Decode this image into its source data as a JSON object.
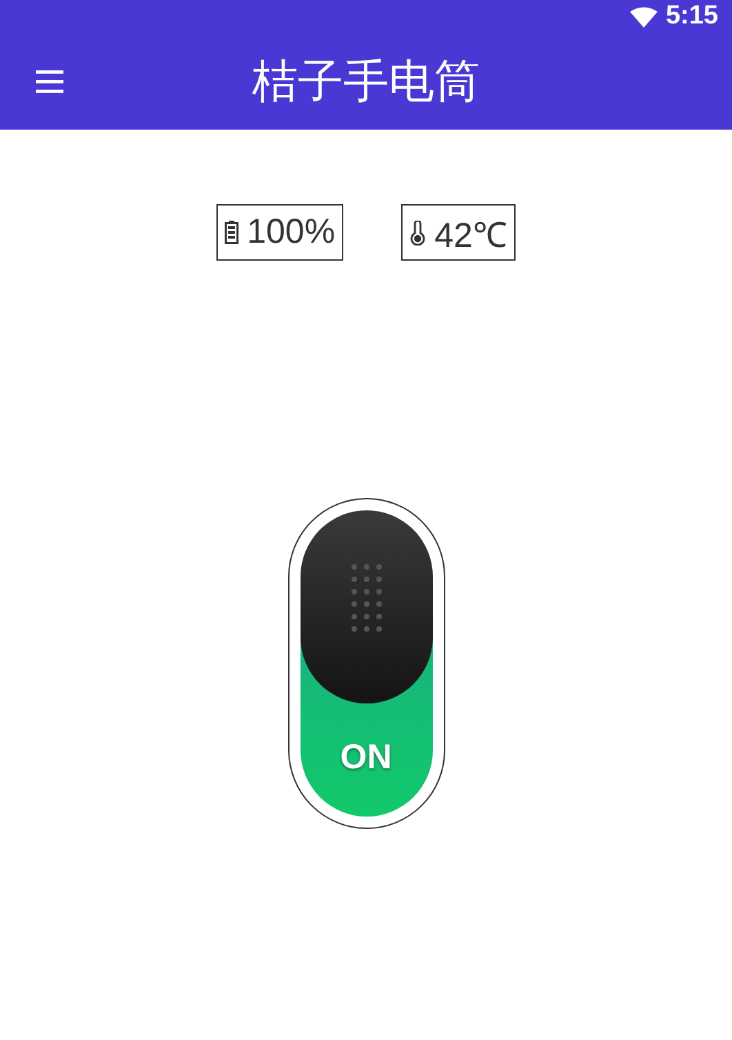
{
  "status_bar": {
    "time": "5:15"
  },
  "app_bar": {
    "title": "桔子手电筒"
  },
  "indicators": [
    {
      "kind": "battery",
      "reading": "100%"
    },
    {
      "kind": "temperature",
      "reading": "42℃"
    }
  ],
  "power_switch": {
    "label": "ON",
    "on": true
  }
}
